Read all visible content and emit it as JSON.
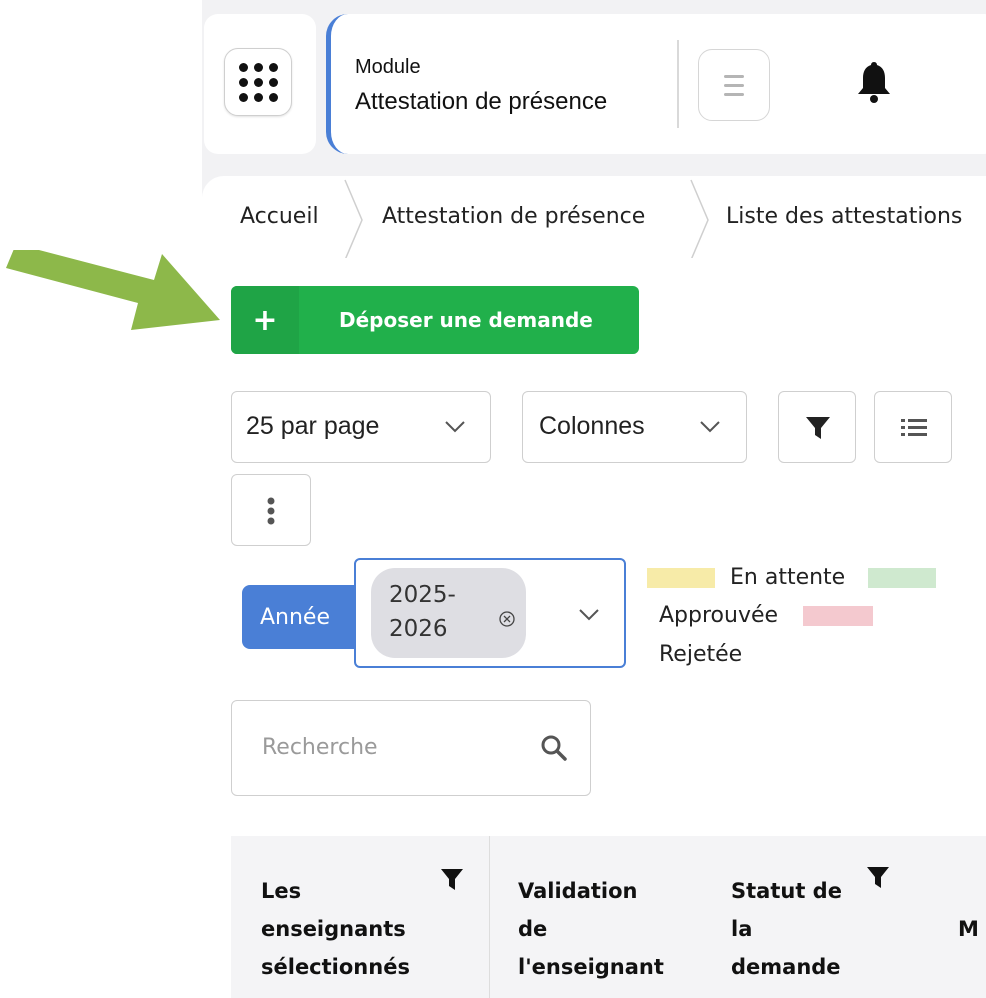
{
  "header": {
    "module_label": "Module",
    "module_name": "Attestation de présence",
    "icons": {
      "apps": "grid-icon",
      "menu": "hamburger-icon",
      "notifications": "bell-icon"
    },
    "accent_color": "#4a7fd6"
  },
  "breadcrumb": [
    "Accueil",
    "Attestation de présence",
    "Liste des attestations"
  ],
  "actions": {
    "deposit_label": "Déposer une demande",
    "deposit_icon_text": "+",
    "deposit_color": "#21b04b"
  },
  "toolbar": {
    "per_page": "25 par page",
    "columns": "Colonnes",
    "icons": [
      "filter-icon",
      "list-icon",
      "kebab-icon"
    ]
  },
  "filters": {
    "year_label": "Année",
    "year_value_line1": "2025-",
    "year_value_line2": "2026"
  },
  "legend": [
    {
      "label": "En attente",
      "color": "#f7eba8"
    },
    {
      "label": "Approuvée",
      "color": "#cfe9cf"
    },
    {
      "label": "Rejetée",
      "color": "#f4c9cf"
    }
  ],
  "search": {
    "placeholder": "Recherche"
  },
  "table": {
    "headers": [
      {
        "line1": "Les",
        "line2": "enseignants",
        "line3": "sélectionnés"
      },
      {
        "line1": "Validation",
        "line2": "de",
        "line3": "l'enseignant"
      },
      {
        "line1": "Statut de",
        "line2": "la",
        "line3": "demande"
      },
      {
        "line1": "M"
      }
    ]
  },
  "annotation": {
    "arrow_color": "#8db84a"
  }
}
